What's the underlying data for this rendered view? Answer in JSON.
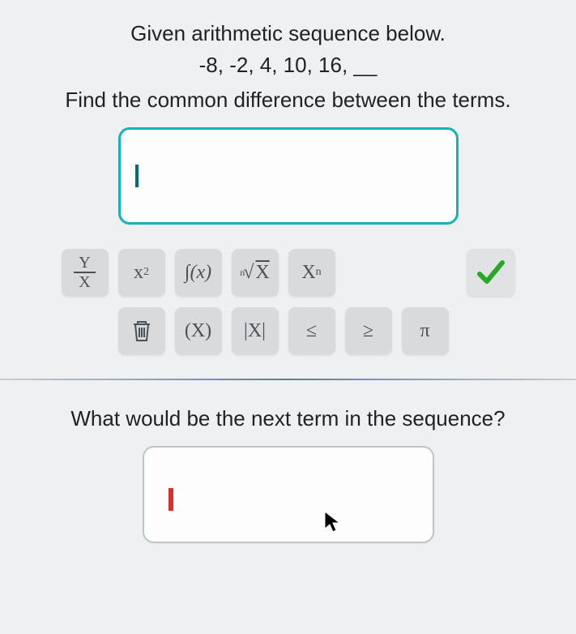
{
  "problem": {
    "intro": "Given arithmetic sequence below.",
    "sequence": "-8, -2, 4, 10, 16, __",
    "question1": "Find the common difference between the terms.",
    "question2": "What would be the next term in the sequence?"
  },
  "toolbar": {
    "fraction_num": "Y",
    "fraction_den": "X",
    "power": "x",
    "power_sup": "2",
    "func": "∫(x)",
    "nthroot_n": "n",
    "nthroot": "√",
    "nthroot_x": "X",
    "subscript": "X",
    "subscript_n": "n",
    "paren": "(X)",
    "abs": "|X|",
    "le": "≤",
    "ge": "≥",
    "pi": "π"
  }
}
